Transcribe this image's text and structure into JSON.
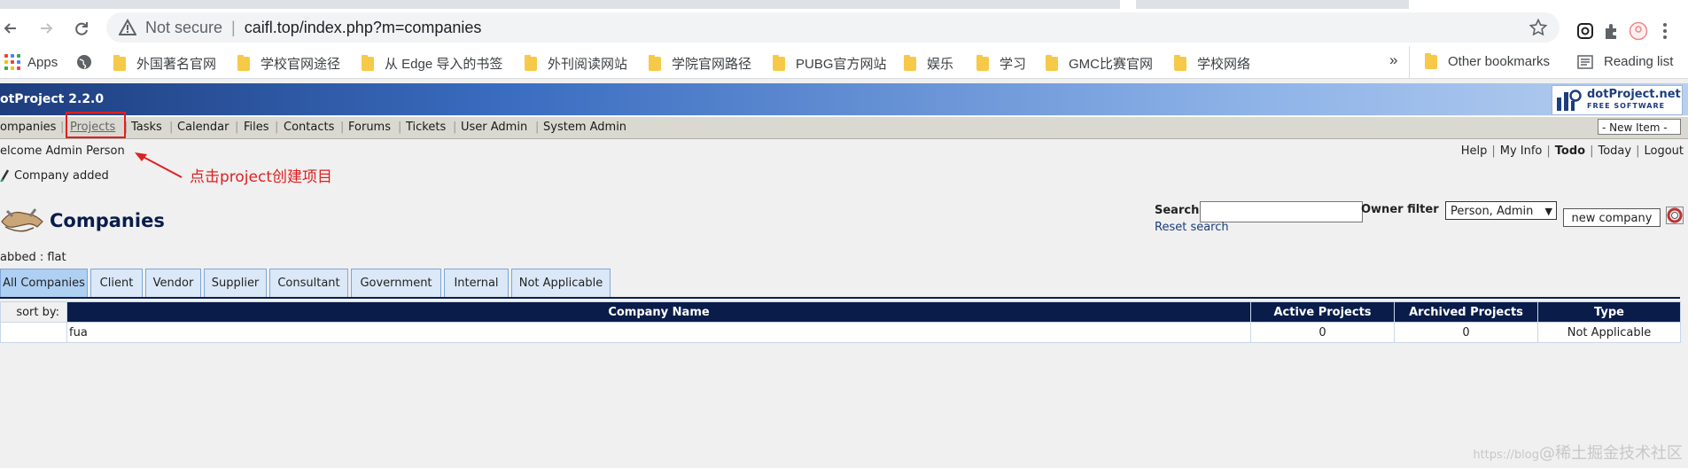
{
  "browser": {
    "security_label": "Not secure",
    "separator": "|",
    "url": "caifl.top/index.php?m=companies",
    "bookmarks": [
      {
        "label": "Apps",
        "icon": "apps-grid-icon"
      },
      {
        "label": "",
        "icon": "globe-icon"
      },
      {
        "label": "外国著名官网",
        "icon": "folder-icon"
      },
      {
        "label": "学校官网途径",
        "icon": "folder-icon"
      },
      {
        "label": "从 Edge 导入的书签",
        "icon": "folder-icon"
      },
      {
        "label": "外刊阅读网站",
        "icon": "folder-icon"
      },
      {
        "label": "学院官网路径",
        "icon": "folder-icon"
      },
      {
        "label": "PUBG官方网站",
        "icon": "folder-icon"
      },
      {
        "label": "娱乐",
        "icon": "folder-icon"
      },
      {
        "label": "学习",
        "icon": "folder-icon"
      },
      {
        "label": "GMC比赛官网",
        "icon": "folder-icon"
      },
      {
        "label": "学校网络",
        "icon": "folder-icon"
      }
    ],
    "more_label": "»",
    "other_bookmarks": "Other bookmarks",
    "reading_list": "Reading list"
  },
  "app": {
    "version": "otProject 2.2.0",
    "logo_title": "dotProject.net",
    "logo_subtitle": "FREE SOFTWARE",
    "menu": [
      "ompanies",
      "Projects",
      "Tasks",
      "Calendar",
      "Files",
      "Contacts",
      "Forums",
      "Tickets",
      "User Admin",
      "System Admin"
    ],
    "menu_separator": "|",
    "new_item": "- New Item -",
    "welcome": "elcome Admin Person",
    "top_links": {
      "help": "Help",
      "my_info": "My Info",
      "todo": "Todo",
      "today": "Today",
      "logout": "Logout",
      "separator": "|"
    },
    "message": "Company added",
    "annotation": "点击project创建项目",
    "page_title": "Companies",
    "search_label": "Search",
    "search_value": "",
    "owner_filter_label": "Owner filter",
    "owner_filter_value": "Person, Admin",
    "reset_search": "Reset search",
    "new_company": "new company",
    "tabbed_label": "abbed : flat",
    "tabs": [
      "All Companies",
      "Client",
      "Vendor",
      "Supplier",
      "Consultant",
      "Government",
      "Internal",
      "Not Applicable"
    ],
    "active_tab": "All Companies",
    "table": {
      "sort_by": "sort by:",
      "headers": [
        "Company Name",
        "Active Projects",
        "Archived Projects",
        "Type"
      ],
      "rows": [
        {
          "name": "fua",
          "active": "0",
          "archived": "0",
          "type": "Not Applicable"
        }
      ]
    },
    "watermark_small": "https://blog",
    "watermark": "@稀土掘金技术社区"
  },
  "colors": {
    "header_dark": "#1d3d7d",
    "table_header": "#0a1d4a",
    "annotation_red": "#e02020",
    "tab_active": "#aed0f2",
    "tab_inactive": "#dbe8f7"
  }
}
